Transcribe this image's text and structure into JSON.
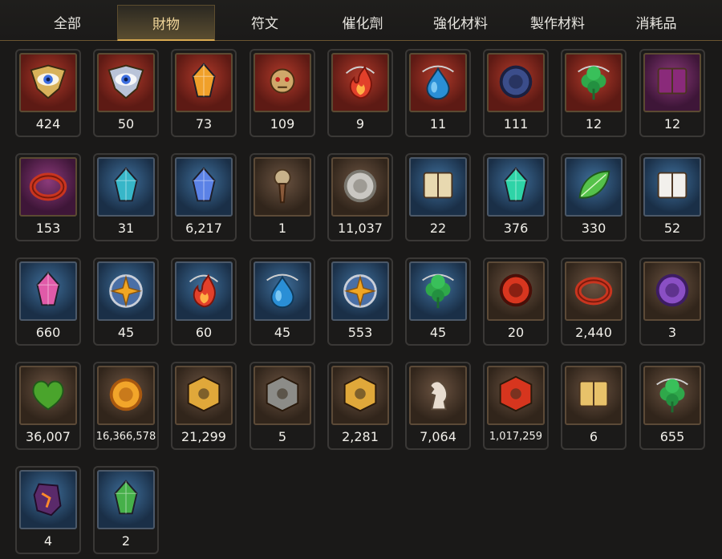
{
  "tabs": [
    {
      "label": "全部"
    },
    {
      "label": "財物"
    },
    {
      "label": "符文"
    },
    {
      "label": "催化劑"
    },
    {
      "label": "強化材料"
    },
    {
      "label": "製作材料"
    },
    {
      "label": "消耗品"
    }
  ],
  "active_tab": "財物",
  "items": [
    {
      "icon": "gold-eye-crest-icon",
      "count": "424",
      "bg": "red"
    },
    {
      "icon": "silver-eye-crest-icon",
      "count": "50",
      "bg": "red"
    },
    {
      "icon": "golden-crystal-shard-icon",
      "count": "73",
      "bg": "red"
    },
    {
      "icon": "beast-skull-amulet-icon",
      "count": "109",
      "bg": "red"
    },
    {
      "icon": "fire-pendant-icon",
      "count": "9",
      "bg": "red"
    },
    {
      "icon": "water-pendant-icon",
      "count": "11",
      "bg": "red"
    },
    {
      "icon": "runic-disc-pendant-icon",
      "count": "111",
      "bg": "red"
    },
    {
      "icon": "clover-pendant-icon",
      "count": "12",
      "bg": "red"
    },
    {
      "icon": "ornate-tome-icon",
      "count": "12",
      "bg": "purple"
    },
    {
      "icon": "broken-ring-icon",
      "count": "153",
      "bg": "purple"
    },
    {
      "icon": "teal-gem-icon",
      "count": "31",
      "bg": "blue"
    },
    {
      "icon": "blue-crystal-icon",
      "count": "6,217",
      "bg": "blue"
    },
    {
      "icon": "compass-dagger-icon",
      "count": "1",
      "bg": "brown"
    },
    {
      "icon": "silver-coin-icon",
      "count": "11,037",
      "bg": "brown"
    },
    {
      "icon": "open-book-icon",
      "count": "22",
      "bg": "blue"
    },
    {
      "icon": "emerald-prism-icon",
      "count": "376",
      "bg": "blue"
    },
    {
      "icon": "green-leaf-icon",
      "count": "330",
      "bg": "blue"
    },
    {
      "icon": "card-scroll-icon",
      "count": "52",
      "bg": "blue"
    },
    {
      "icon": "pink-crystal-mound-icon",
      "count": "660",
      "bg": "blue"
    },
    {
      "icon": "star-medallion-icon",
      "count": "45",
      "bg": "blue"
    },
    {
      "icon": "fire-pendant-icon",
      "count": "60",
      "bg": "blue"
    },
    {
      "icon": "water-pendant-icon",
      "count": "45",
      "bg": "blue"
    },
    {
      "icon": "star-pendant-icon",
      "count": "553",
      "bg": "blue"
    },
    {
      "icon": "clover-pendant-icon",
      "count": "45",
      "bg": "blue"
    },
    {
      "icon": "lava-orb-icon",
      "count": "20",
      "bg": "brown"
    },
    {
      "icon": "red-bracelet-icon",
      "count": "2,440",
      "bg": "brown"
    },
    {
      "icon": "purple-seal-icon",
      "count": "3",
      "bg": "brown"
    },
    {
      "icon": "green-heart-icon",
      "count": "36,007",
      "bg": "brown"
    },
    {
      "icon": "sun-coin-icon",
      "count": "16,366,578",
      "bg": "brown",
      "small": true
    },
    {
      "icon": "gold-hex-emblem-icon",
      "count": "21,299",
      "bg": "brown"
    },
    {
      "icon": "stone-cube-icon",
      "count": "5",
      "bg": "brown"
    },
    {
      "icon": "fist-emblem-icon",
      "count": "2,281",
      "bg": "brown"
    },
    {
      "icon": "chess-knight-icon",
      "count": "7,064",
      "bg": "brown"
    },
    {
      "icon": "red-flame-crest-icon",
      "count": "1,017,259",
      "bg": "brown",
      "small": true
    },
    {
      "icon": "golden-ticket-icon",
      "count": "6",
      "bg": "brown"
    },
    {
      "icon": "four-leaf-clover-icon",
      "count": "655",
      "bg": "brown"
    },
    {
      "icon": "magma-stone-icon",
      "count": "4",
      "bg": "blue"
    },
    {
      "icon": "green-crystal-bundle-icon",
      "count": "2",
      "bg": "blue"
    }
  ],
  "colors": {
    "background": "#1a1918",
    "tab_active_text": "#f2d79a",
    "tab_active_underline": "#d8a950",
    "slot_border": "#3a3836",
    "count_text": "#f1efe9"
  }
}
